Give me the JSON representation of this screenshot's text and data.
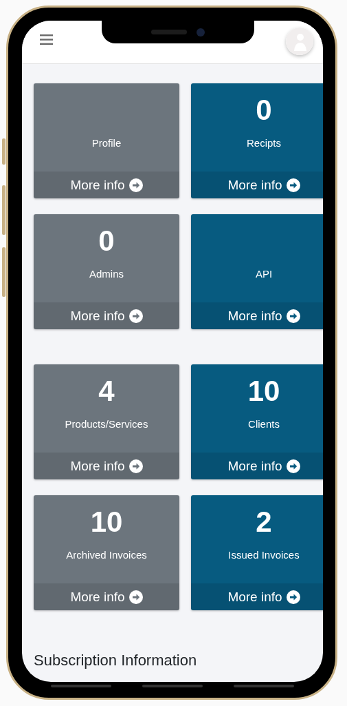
{
  "card_groups": [
    {
      "cards": [
        {
          "label": "Profile",
          "link": "More info",
          "color": "#6c757d"
        },
        {
          "value": "0",
          "label": "Recipts",
          "link": "More info",
          "color": "#075b80"
        },
        {
          "value": "0",
          "label": "Admins",
          "link": "More info",
          "color": "#6c757d"
        },
        {
          "label": "API",
          "link": "More info",
          "color": "#075b80"
        }
      ]
    },
    {
      "cards": [
        {
          "value": "4",
          "label": "Products/Services",
          "link": "More info",
          "color": "#6c757d"
        },
        {
          "value": "10",
          "label": "Clients",
          "link": "More info",
          "color": "#075b80"
        },
        {
          "value": "10",
          "label": "Archived Invoices",
          "link": "More info",
          "color": "#6c757d"
        },
        {
          "value": "2",
          "label": "Issued Invoices",
          "link": "More info",
          "color": "#075b80"
        }
      ]
    }
  ],
  "section_title": "Subscription Information"
}
